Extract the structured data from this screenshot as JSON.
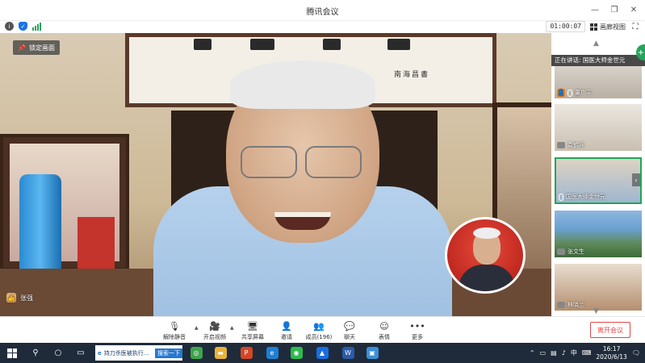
{
  "window": {
    "title": "腾讯会议",
    "controls": [
      "—",
      "❐",
      "✕"
    ],
    "control_names": [
      "minimize",
      "restore",
      "close"
    ]
  },
  "infobar": {
    "timer": "01:00:07",
    "gallery_label": "画廊视图"
  },
  "main_video": {
    "lock_label": "锁定画面",
    "speaker_name": "张强",
    "calligraphy_signature": "南海昌書"
  },
  "sidebar": {
    "speaking_label": "正在讲话: 国医大师金世元",
    "participants": [
      {
        "name": "董广平",
        "mic": "on",
        "avatar_icon": "user-icon"
      },
      {
        "name": "袁鹤兵",
        "mic": "off"
      },
      {
        "name": "国医大师金世元",
        "mic": "on",
        "active": true
      },
      {
        "name": "张文生",
        "mic": "off"
      },
      {
        "name": "林晓兰",
        "mic": "off"
      }
    ]
  },
  "toolbar": {
    "items": [
      {
        "label": "解除静音",
        "icon": "mic-muted-icon"
      },
      {
        "label": "开启视频",
        "icon": "camera-off-icon"
      },
      {
        "label": "共享屏幕",
        "icon": "share-screen-icon"
      },
      {
        "label": "邀请",
        "icon": "invite-icon"
      },
      {
        "label": "成员(196)",
        "icon": "members-icon"
      },
      {
        "label": "聊天",
        "icon": "chat-icon"
      },
      {
        "label": "表情",
        "icon": "emoji-icon"
      },
      {
        "label": "更多",
        "icon": "more-icon"
      }
    ],
    "leave_label": "离开会议"
  },
  "taskbar": {
    "ie_title": "持刀杀医被执行...",
    "ie_search": "搜索一下",
    "ime": "中",
    "time": "16:17",
    "date": "2020/6/13"
  },
  "colors": {
    "accent_green": "#23a55a",
    "leave_red": "#e04848",
    "taskbar": "#1f2b3a"
  }
}
